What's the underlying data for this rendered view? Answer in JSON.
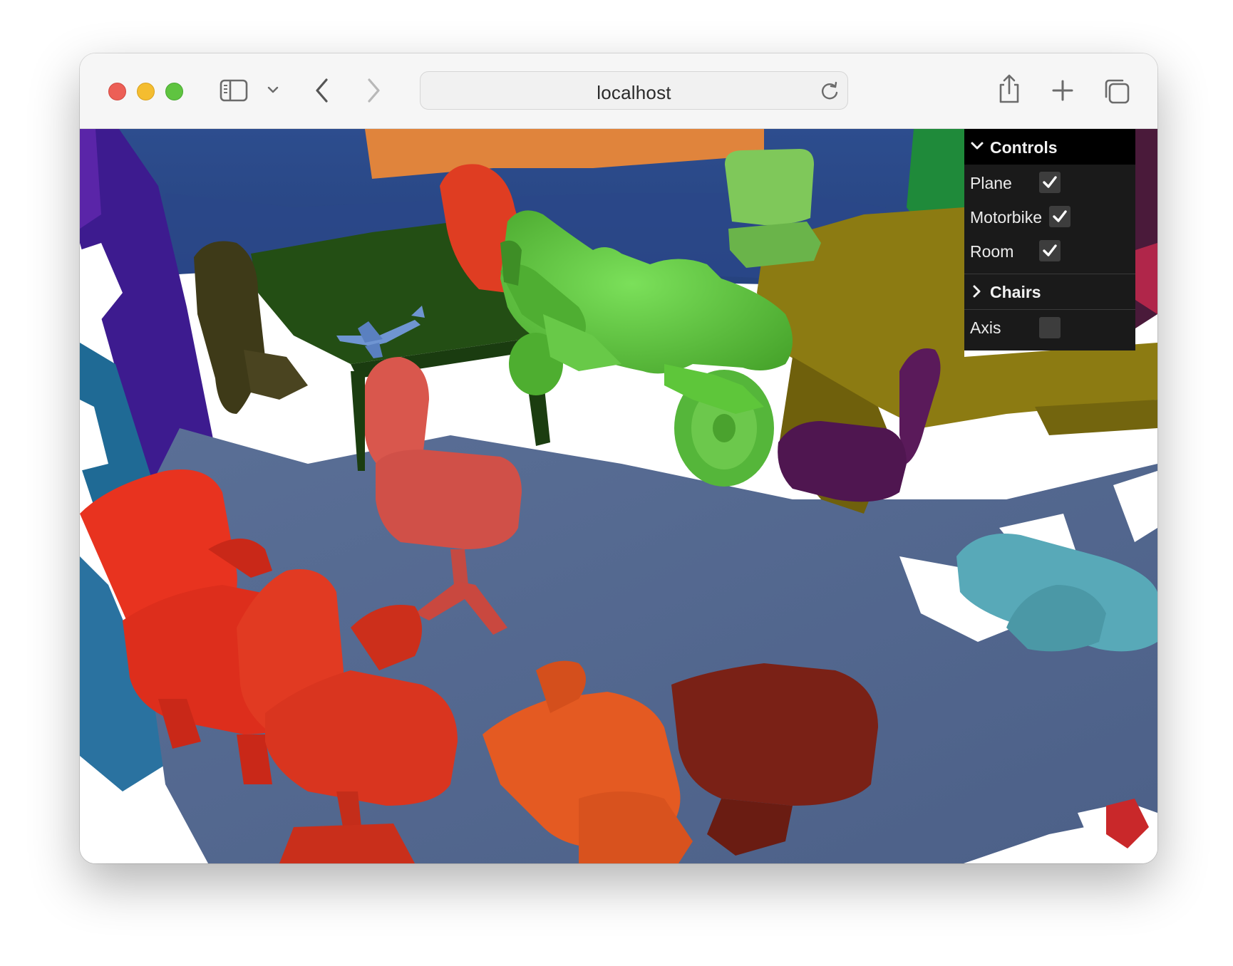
{
  "browser": {
    "url": "localhost",
    "icons": [
      "sidebar-icon",
      "chevron-down-icon",
      "back-arrow-icon",
      "forward-arrow-icon",
      "reload-icon",
      "share-icon",
      "new-tab-plus-icon",
      "tab-overview-icon"
    ]
  },
  "controls": {
    "title": "Controls",
    "items": [
      {
        "label": "Plane",
        "checked": true
      },
      {
        "label": "Motorbike",
        "checked": true
      },
      {
        "label": "Room",
        "checked": true
      }
    ],
    "folder": {
      "label": "Chairs",
      "collapsed": true
    },
    "axis": {
      "label": "Axis",
      "checked": false
    }
  },
  "scene": {
    "objects": [
      "room",
      "floor",
      "table",
      "desk",
      "motorbike",
      "plane",
      "chairs"
    ],
    "colors": {
      "floor": "#53688e",
      "wall": "#2c4b8a",
      "motorbike": "#5ec63a",
      "table": "#1f4a12",
      "desk": "#8a7a10",
      "chair_red": "#e8331f",
      "chair_pink": "#d9574d",
      "chair_orange": "#e45a22",
      "chair_maroon": "#7a2116",
      "chair_purple": "#5a1a5a",
      "chair_teal": "#58a9b8",
      "chair_lightgreen": "#7fc85a",
      "chair_olive": "#3e3a18",
      "plane": "#6f95d2",
      "orange_wall": "#e0843c"
    }
  }
}
